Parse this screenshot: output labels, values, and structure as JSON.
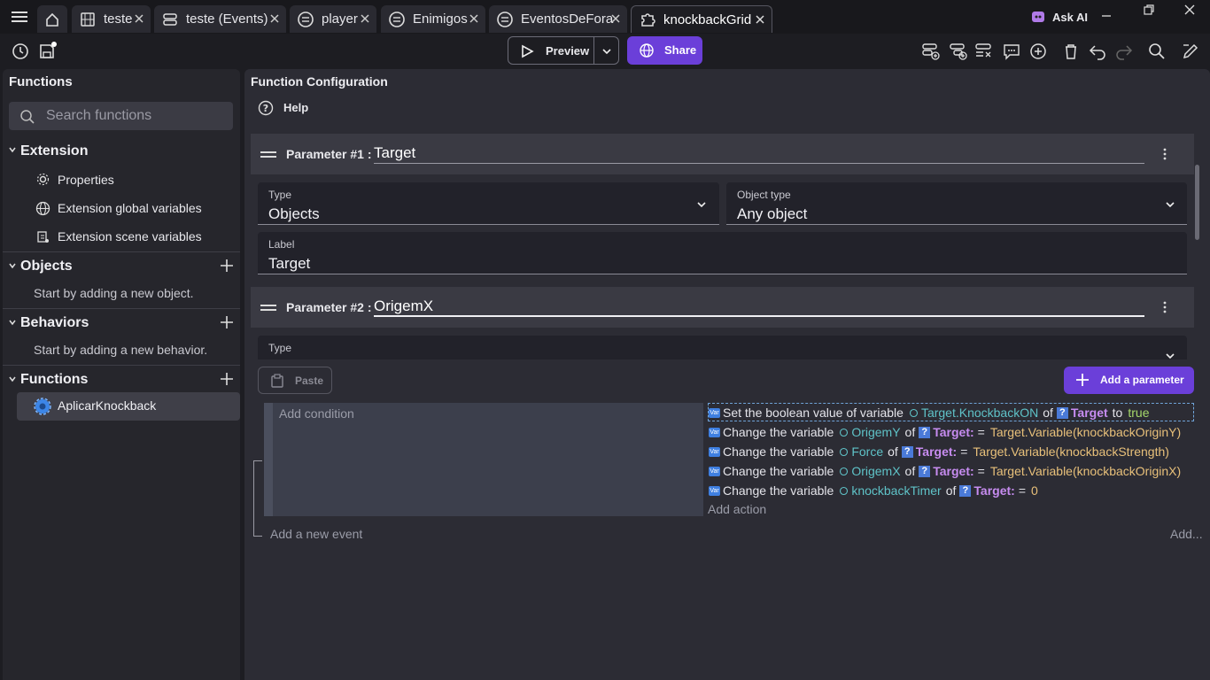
{
  "tabs": [
    {
      "label": "teste",
      "icon": "film-icon"
    },
    {
      "label": "teste (Events)",
      "icon": "events-icon"
    },
    {
      "label": "player",
      "icon": "object-icon"
    },
    {
      "label": "Enimigos",
      "icon": "object-icon"
    },
    {
      "label": "EventosDeFora",
      "icon": "object-icon"
    },
    {
      "label": "knockbackGrid",
      "icon": "puzzle-icon"
    }
  ],
  "ask_ai": "Ask AI",
  "toolbar": {
    "preview": "Preview",
    "share": "Share"
  },
  "left": {
    "title": "Functions",
    "search_placeholder": "Search functions",
    "extension": {
      "title": "Extension",
      "items": [
        "Properties",
        "Extension global variables",
        "Extension scene variables"
      ]
    },
    "objects": {
      "title": "Objects",
      "empty": "Start by adding a new object."
    },
    "behaviors": {
      "title": "Behaviors",
      "empty": "Start by adding a new behavior."
    },
    "functions": {
      "title": "Functions",
      "items": [
        "AplicarKnockback"
      ]
    }
  },
  "right": {
    "title": "Function Configuration",
    "help": "Help",
    "param1": {
      "label": "Parameter #1 :",
      "name": "Target",
      "type_label": "Type",
      "type_value": "Objects",
      "objtype_label": "Object type",
      "objtype_value": "Any object",
      "label_label": "Label",
      "label_value": "Target"
    },
    "param2": {
      "label": "Parameter #2 :",
      "name": "OrigemX",
      "type_label": "Type"
    },
    "paste": "Paste",
    "add_param": "Add a parameter"
  },
  "events": {
    "add_condition": "Add condition",
    "add_action": "Add action",
    "add_event": "Add a new event",
    "add_more": "Add...",
    "actions": [
      {
        "pre": "Set the boolean value of variable",
        "var": "Target.KnockbackON",
        "mid": "of",
        "obj": "Target",
        "op": "to",
        "val": "true"
      },
      {
        "pre": "Change the variable",
        "var": "OrigemY",
        "mid": "of",
        "obj": "Target:",
        "op": "=",
        "val": "Target.Variable(knockbackOriginY)"
      },
      {
        "pre": "Change the variable",
        "var": "Force",
        "mid": "of",
        "obj": "Target:",
        "op": "=",
        "val": "Target.Variable(knockbackStrength)"
      },
      {
        "pre": "Change the variable",
        "var": "OrigemX",
        "mid": "of",
        "obj": "Target:",
        "op": "=",
        "val": "Target.Variable(knockbackOriginX)"
      },
      {
        "pre": "Change the variable",
        "var": "knockbackTimer",
        "mid": "of",
        "obj": "Target:",
        "op": "=",
        "val": "0"
      }
    ]
  }
}
